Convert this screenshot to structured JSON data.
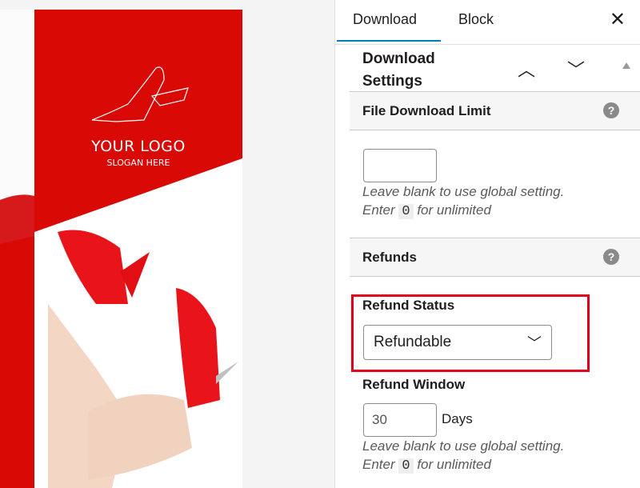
{
  "canvas": {
    "logo_title": "YOUR LOGO",
    "logo_slogan": "SLOGAN HERE",
    "brand_color": "#d90a06"
  },
  "tabs": [
    {
      "label": "Download",
      "active": true
    },
    {
      "label": "Block",
      "active": false
    }
  ],
  "close_icon": "close-icon",
  "panel": {
    "title_line1": "Download",
    "title_line2": "Settings"
  },
  "file_download_limit": {
    "title": "File Download Limit",
    "value": "",
    "hint_line1": "Leave blank to use global setting.",
    "hint_pre": "Enter",
    "hint_code": "0",
    "hint_post": "for unlimited"
  },
  "refunds": {
    "title": "Refunds",
    "status_label": "Refund Status",
    "status_value": "Refundable",
    "window_label": "Refund Window",
    "window_value": "30",
    "window_unit": "Days",
    "hint_line1": "Leave blank to use global setting.",
    "hint_pre": "Enter",
    "hint_code": "0",
    "hint_post": "for unlimited"
  },
  "highlight_color": "#e4001b"
}
